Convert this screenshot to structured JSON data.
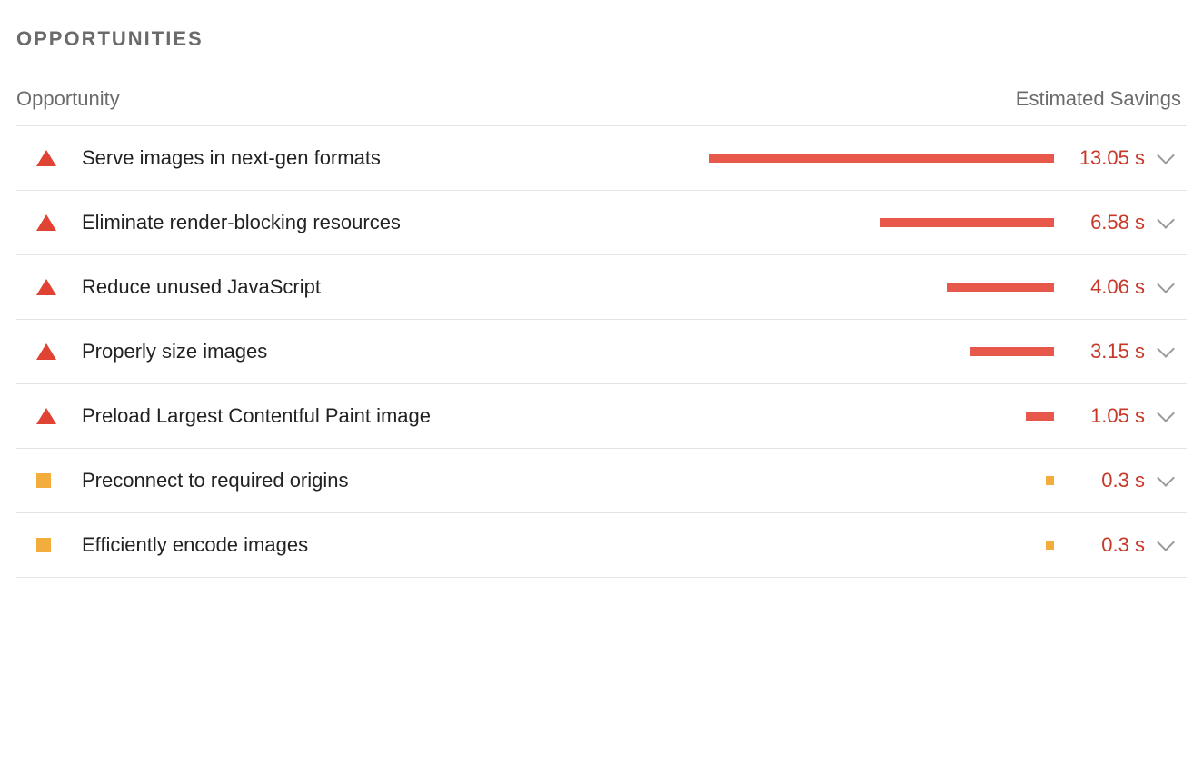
{
  "section_title": "OPPORTUNITIES",
  "header": {
    "opportunity": "Opportunity",
    "estimated_savings": "Estimated Savings"
  },
  "max_savings_seconds": 13.05,
  "opportunities": [
    {
      "severity": "fail",
      "label": "Serve images in next-gen formats",
      "savings_value": "13.05",
      "savings_unit": "s",
      "savings_seconds": 13.05
    },
    {
      "severity": "fail",
      "label": "Eliminate render-blocking resources",
      "savings_value": "6.58 s",
      "savings_unit": "",
      "savings_seconds": 6.58
    },
    {
      "severity": "fail",
      "label": "Reduce unused JavaScript",
      "savings_value": "4.06 s",
      "savings_unit": "",
      "savings_seconds": 4.06
    },
    {
      "severity": "fail",
      "label": "Properly size images",
      "savings_value": "3.15 s",
      "savings_unit": "",
      "savings_seconds": 3.15
    },
    {
      "severity": "fail",
      "label": "Preload Largest Contentful Paint image",
      "savings_value": "1.05 s",
      "savings_unit": "",
      "savings_seconds": 1.05
    },
    {
      "severity": "warn",
      "label": "Preconnect to required origins",
      "savings_value": "0.3 s",
      "savings_unit": "",
      "savings_seconds": 0.3
    },
    {
      "severity": "warn",
      "label": "Efficiently encode images",
      "savings_value": "0.3 s",
      "savings_unit": "",
      "savings_seconds": 0.3
    }
  ]
}
